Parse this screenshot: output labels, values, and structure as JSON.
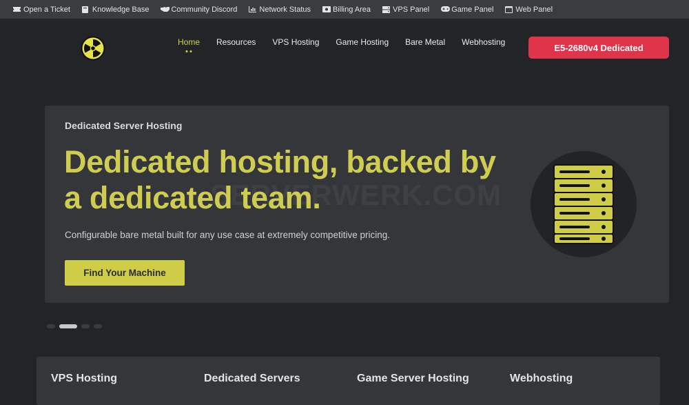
{
  "topbar": {
    "links": [
      {
        "label": "Open a Ticket",
        "icon": "ticket-icon"
      },
      {
        "label": "Knowledge Base",
        "icon": "book-icon"
      },
      {
        "label": "Community Discord",
        "icon": "handshake-icon"
      },
      {
        "label": "Network Status",
        "icon": "chart-icon"
      },
      {
        "label": "Billing Area",
        "icon": "wallet-icon"
      },
      {
        "label": "VPS Panel",
        "icon": "server-icon"
      },
      {
        "label": "Game Panel",
        "icon": "gamepad-icon"
      },
      {
        "label": "Web Panel",
        "icon": "window-icon"
      }
    ]
  },
  "nav": {
    "items": [
      "Home",
      "Resources",
      "VPS Hosting",
      "Game Hosting",
      "Bare Metal",
      "Webhosting"
    ],
    "active": "Home",
    "cta": "E5-2680v4 Dedicated"
  },
  "hero": {
    "eyebrow": "Dedicated Server Hosting",
    "headline": "Dedicated hosting, backed by a dedicated team.",
    "watermark": "SERVERWERK.COM",
    "subtitle": "Configurable bare metal built for any use case at extremely competitive pricing.",
    "button": "Find Your Machine"
  },
  "carousel": {
    "count": 4,
    "active": 1
  },
  "bottom": {
    "columns": [
      "VPS Hosting",
      "Dedicated Servers",
      "Game Server Hosting",
      "Webhosting"
    ]
  },
  "colors": {
    "accent": "#cfcc48",
    "cta": "#e0344a",
    "background": "#222428",
    "card": "#34363a"
  }
}
